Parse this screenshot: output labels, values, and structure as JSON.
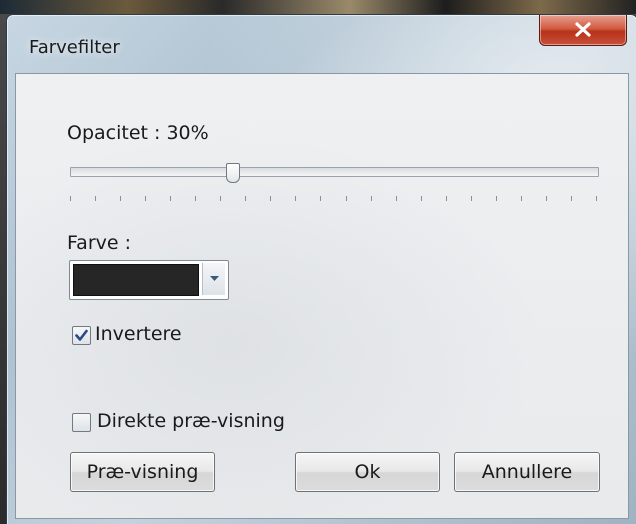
{
  "window": {
    "title": "Farvefilter"
  },
  "opacity": {
    "label": "Opacitet : 30%",
    "value_percent": 30,
    "tick_count": 22
  },
  "color": {
    "label": "Farve :",
    "selected_color": "#262626"
  },
  "invert": {
    "label": "Invertere",
    "checked": true
  },
  "direct_preview": {
    "label": "Direkte præ-visning",
    "checked": false
  },
  "buttons": {
    "preview": "Præ-visning",
    "ok": "Ok",
    "cancel": "Annullere"
  },
  "icons": {
    "close": "close-icon",
    "dropdown": "chevron-down-icon",
    "check": "checkmark-icon"
  },
  "colors": {
    "close_button": "#c9503a",
    "check_mark": "#2b4a8a"
  }
}
